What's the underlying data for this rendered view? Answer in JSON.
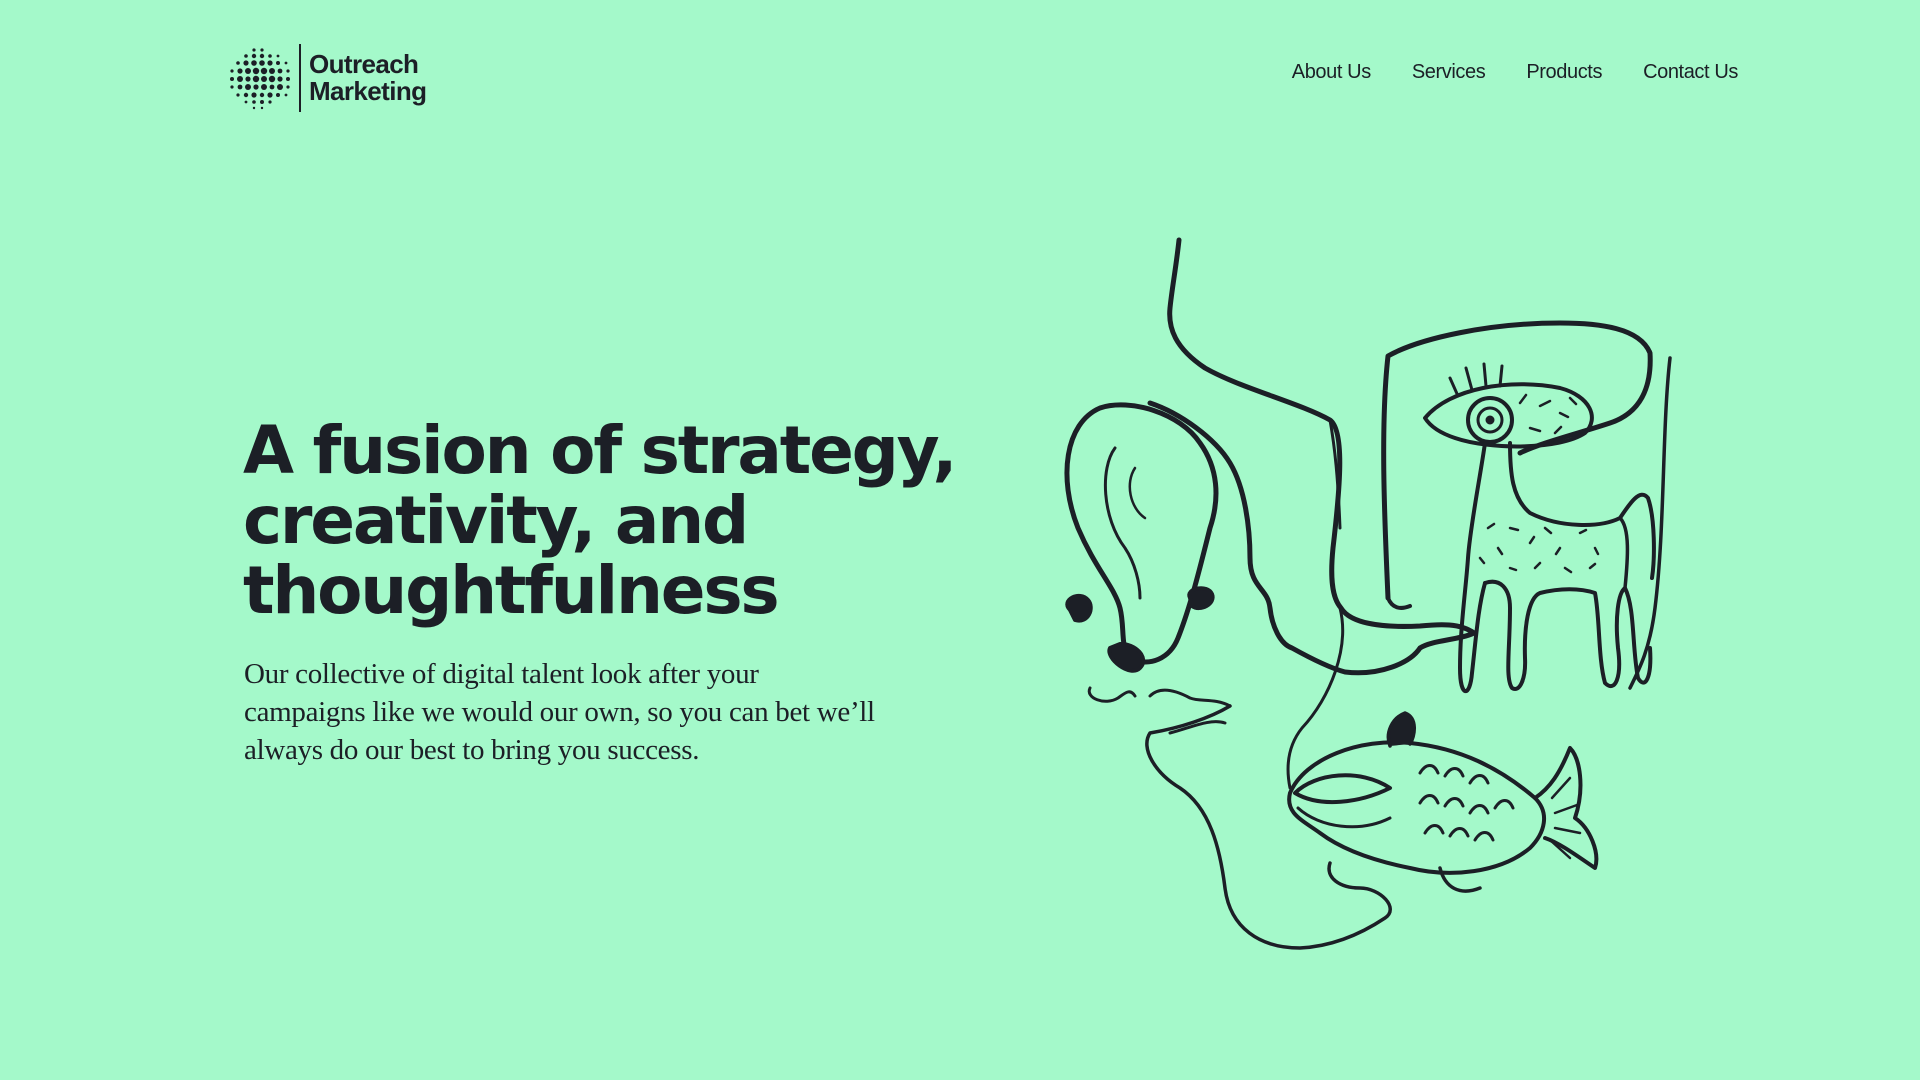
{
  "header": {
    "logo": {
      "line1": "Outreach",
      "line2": "Marketing"
    },
    "nav": [
      {
        "label": "About Us"
      },
      {
        "label": "Services"
      },
      {
        "label": "Products"
      },
      {
        "label": "Contact Us"
      }
    ]
  },
  "hero": {
    "title_lines": [
      "A fusion of strategy,",
      "creativity, and",
      "thoughtfulness"
    ],
    "body": "Our collective of digital talent look after your campaigns like we would our own, so you can bet we’ll always do our best to bring you success."
  },
  "illustration": {
    "name": "line-drawing-face-illustration"
  },
  "colors": {
    "background": "#a4f9ca",
    "ink": "#1c1f26"
  }
}
